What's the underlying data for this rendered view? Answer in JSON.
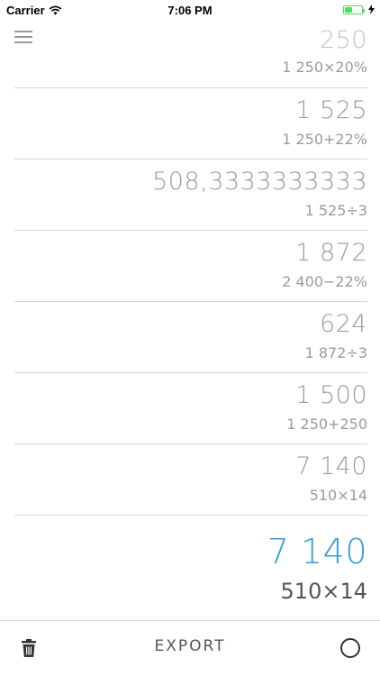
{
  "status_bar": {
    "carrier": "Carrier",
    "time": "7:06 PM"
  },
  "history": [
    {
      "result": "250",
      "expression": "1 250×20%"
    },
    {
      "result": "1 525",
      "expression": "1 250+22%"
    },
    {
      "result": "508,3333333333",
      "expression": "1 525÷3"
    },
    {
      "result": "1 872",
      "expression": "2 400−22%"
    },
    {
      "result": "624",
      "expression": "1 872÷3"
    },
    {
      "result": "1 500",
      "expression": "1 250+250"
    },
    {
      "result": "7 140",
      "expression": "510×14"
    }
  ],
  "current": {
    "result": "7 140",
    "expression": "510×14"
  },
  "toolbar": {
    "export_label": "EXPORT"
  },
  "colors": {
    "accent": "#3a9ad9",
    "muted_text": "#9b9b9b",
    "battery": "#4cd964"
  },
  "icons": {
    "menu": "hamburger-icon",
    "wifi": "wifi-icon",
    "battery": "battery-icon",
    "trash": "trash-icon",
    "circle": "circle-icon"
  }
}
